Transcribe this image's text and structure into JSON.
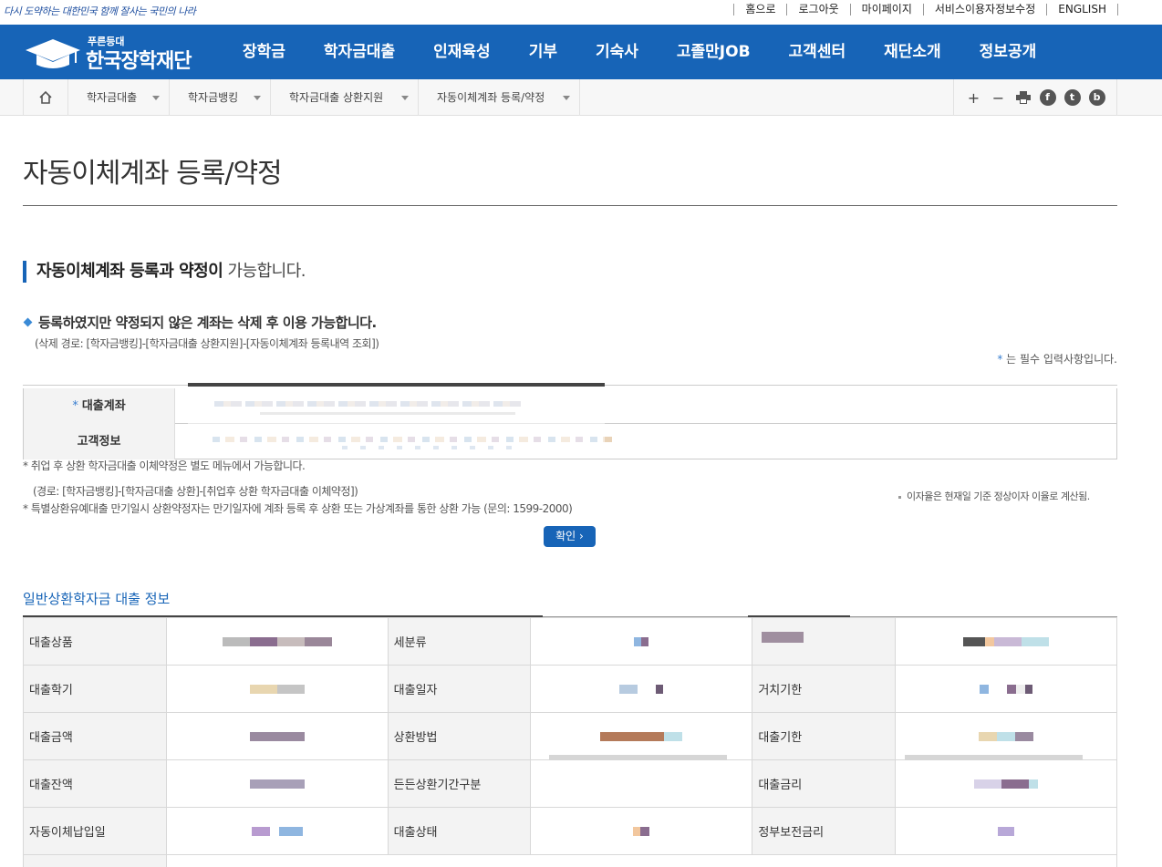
{
  "util": {
    "slogan": "다시 도약하는 대한민국 함께 잘사는 국민의 나라",
    "links": [
      "홈으로",
      "로그아웃",
      "마이페이지",
      "서비스이용자정보수정",
      "ENGLISH"
    ]
  },
  "header": {
    "logo_sub": "푸른등대",
    "logo_name": "한국장학재단",
    "menus": [
      "장학금",
      "학자금대출",
      "인재육성",
      "기부",
      "기숙사",
      "고졸만JOB",
      "고객센터",
      "재단소개",
      "정보공개"
    ]
  },
  "breadcrumb": {
    "items": [
      "학자금대출",
      "학자금뱅킹",
      "학자금대출 상환지원",
      "자동이체계좌 등록/약정"
    ]
  },
  "page": {
    "title": "자동이체계좌 등록/약정",
    "section_bold": "자동이체계좌 등록과 약정이",
    "section_rest": " 가능합니다.",
    "notice": "등록하였지만 약정되지 않은 계좌는 삭제 후 이용 가능합니다.",
    "notice_path": "(삭제 경로: [학자금뱅킹]-[학자금대출 상환지원]-[자동이체계좌 등록내역 조회])",
    "required_mark": "*",
    "required_text": " 는 필수 입력사항입니다."
  },
  "form": {
    "account_label": "대출계좌",
    "customer_label": "고객정보",
    "star": "*"
  },
  "notes": {
    "note1": "* 취업 후 상환 학자금대출 이체약정은 별도 메뉴에서 가능합니다.",
    "note1_path": "(경로: [학자금뱅킹]-[학자금대출 상환]-[취업후 상환 학자금대출 이체약정])",
    "note2": "* 특별상환유예대출 만기일시 상환약정자는 만기일자에 계좌 등록 후 상환 또는 가상계좌를 통한 상환 가능 (문의: 1599-2000)",
    "rate": "이자율은 현재일 기준 정상이자 이율로 계산됨.",
    "confirm": "확인"
  },
  "info": {
    "title": "일반상환학자금 대출 정보",
    "rows": [
      [
        "대출상품",
        "세분류",
        ""
      ],
      [
        "대출학기",
        "대출일자",
        "거치기한"
      ],
      [
        "대출금액",
        "상환방법",
        "대출기한"
      ],
      [
        "대출잔액",
        "든든상환기간구분",
        "대출금리"
      ],
      [
        "자동이체납입일",
        "대출상태",
        "정부보전금리"
      ]
    ]
  },
  "colors": {
    "brand_blue": "#1764b7",
    "accent_blue": "#3a7fd0"
  }
}
